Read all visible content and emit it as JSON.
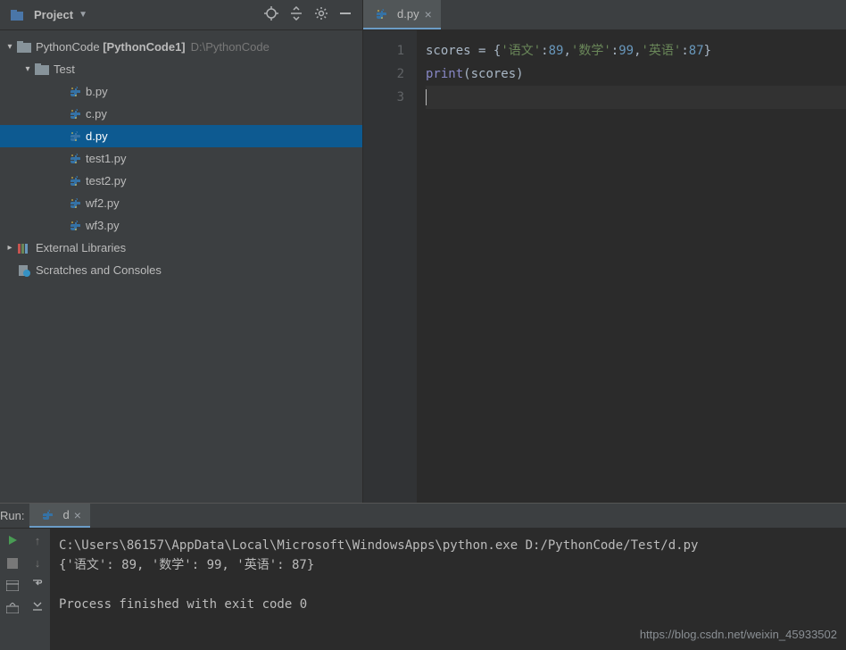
{
  "sidebar": {
    "title": "Project",
    "root": {
      "name": "PythonCode",
      "bracket": "[PythonCode1]",
      "path": "D:\\PythonCode"
    },
    "testFolder": "Test",
    "files": [
      "b.py",
      "c.py",
      "d.py",
      "test1.py",
      "test2.py",
      "wf2.py",
      "wf3.py"
    ],
    "selectedFile": "d.py",
    "external": "External Libraries",
    "scratches": "Scratches and Consoles"
  },
  "editor": {
    "tab": {
      "name": "d.py"
    },
    "lines": [
      "1",
      "2",
      "3"
    ],
    "code": {
      "l1_id": "scores",
      "l1_s1": "'语文'",
      "l1_n1": "89",
      "l1_s2": "'数学'",
      "l1_n2": "99",
      "l1_s3": "'英语'",
      "l1_n3": "87",
      "l2_fn": "print",
      "l2_arg": "scores"
    }
  },
  "run": {
    "label": "Run:",
    "tab": "d",
    "out_cmd": "C:\\Users\\86157\\AppData\\Local\\Microsoft\\WindowsApps\\python.exe D:/PythonCode/Test/d.py",
    "out_result": "{'语文': 89, '数学': 99, '英语': 87}",
    "out_exit": "Process finished with exit code 0"
  },
  "watermark": "https://blog.csdn.net/weixin_45933502"
}
